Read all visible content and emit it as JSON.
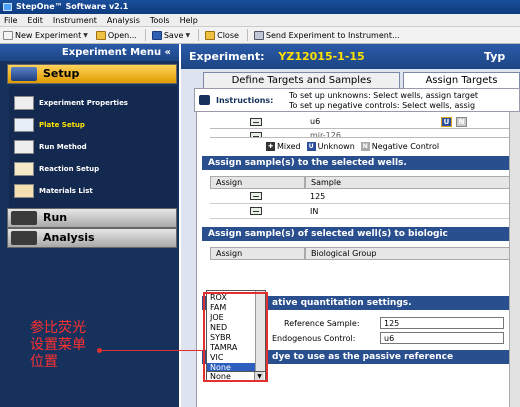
{
  "window": {
    "title": "StepOne™ Software v2.1"
  },
  "menubar": {
    "items": [
      "File",
      "Edit",
      "Instrument",
      "Analysis",
      "Tools",
      "Help"
    ]
  },
  "toolbar": {
    "new_experiment": "New Experiment",
    "open": "Open...",
    "save": "Save",
    "close": "Close",
    "send": "Send Experiment to Instrument..."
  },
  "experiment_menu": {
    "title": "Experiment Menu «",
    "setup": "Setup",
    "setup_items": [
      "Experiment Properties",
      "Plate Setup",
      "Run Method",
      "Reaction Setup",
      "Materials List"
    ],
    "run": "Run",
    "analysis": "Analysis"
  },
  "header": {
    "label": "Experiment:",
    "name": "YZ12015-1-15",
    "type_label": "Typ"
  },
  "tabs": [
    "Define Targets and Samples",
    "Assign Targets"
  ],
  "instructions": {
    "label": "Instructions:",
    "line1": "To set up unknowns: Select wells, assign target",
    "line2": "To set up negative controls: Select wells, assig"
  },
  "targets": {
    "rows": [
      "u6",
      "mir-126"
    ]
  },
  "legend": {
    "mixed": "Mixed",
    "unknown": "Unknown",
    "negative": "Negative Control",
    "u_glyph": "U",
    "n_glyph": "N"
  },
  "assign_samples": {
    "header": "Assign sample(s) to the selected wells.",
    "col_assign": "Assign",
    "col_sample": "Sample",
    "rows": [
      "125",
      "IN"
    ]
  },
  "assign_bio": {
    "header": "Assign sample(s) of selected well(s) to biologic",
    "col_assign": "Assign",
    "col_group": "Biological Group"
  },
  "relative": {
    "header": "ative quantitation settings.",
    "ref_label": "Reference Sample:",
    "ref_value": "125",
    "endo_label": "Endogenous Control:",
    "endo_value": "u6"
  },
  "passive": {
    "header": "dye to use as the passive reference"
  },
  "passive_dropdown": {
    "options": [
      "ROX",
      "FAM",
      "JOE",
      "NED",
      "SYBR",
      "TAMRA",
      "VIC",
      "None"
    ],
    "selected": "None",
    "field_value": "None"
  },
  "annotation": {
    "text": "参比荧光设置菜单位置",
    "color": "#ff3030"
  }
}
